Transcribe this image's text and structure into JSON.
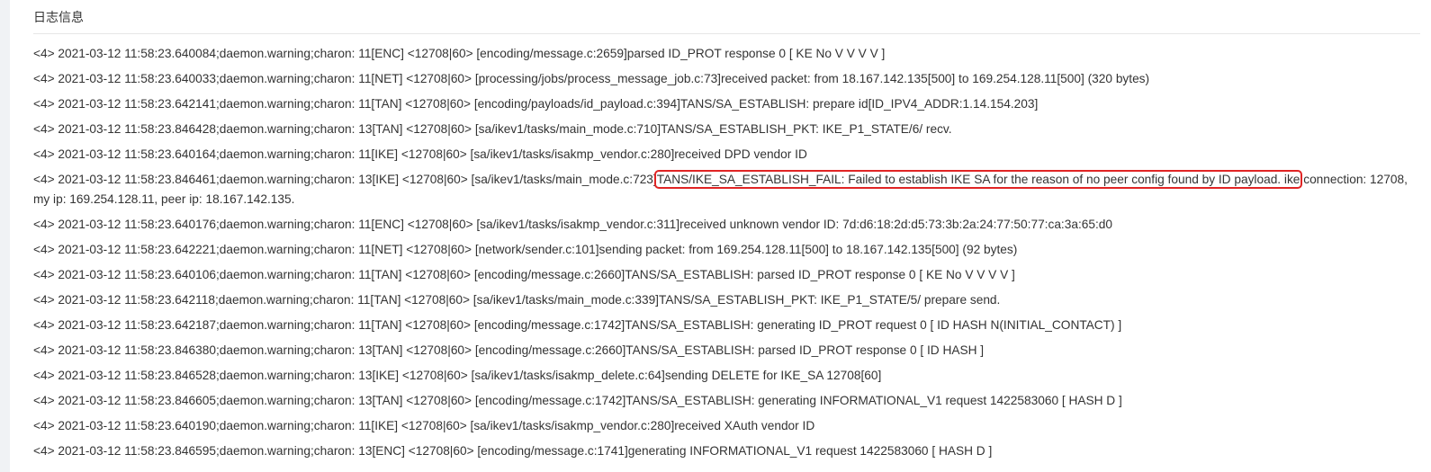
{
  "panel": {
    "title": "日志信息"
  },
  "logs": [
    {
      "prefix": "<4> 2021-03-12 11:58:23.640084;daemon.warning;charon: 11[ENC] <12708|60> [encoding/message.c:2659]parsed ID_PROT response 0 [ KE No V V V V ]",
      "highlight": "",
      "suffix": ""
    },
    {
      "prefix": "<4> 2021-03-12 11:58:23.640033;daemon.warning;charon: 11[NET] <12708|60> [processing/jobs/process_message_job.c:73]received packet: from 18.167.142.135[500] to 169.254.128.11[500] (320 bytes)",
      "highlight": "",
      "suffix": ""
    },
    {
      "prefix": "<4> 2021-03-12 11:58:23.642141;daemon.warning;charon: 11[TAN] <12708|60> [encoding/payloads/id_payload.c:394]TANS/SA_ESTABLISH: prepare id[ID_IPV4_ADDR:1.14.154.203]",
      "highlight": "",
      "suffix": ""
    },
    {
      "prefix": "<4> 2021-03-12 11:58:23.846428;daemon.warning;charon: 13[TAN] <12708|60> [sa/ikev1/tasks/main_mode.c:710]TANS/SA_ESTABLISH_PKT: IKE_P1_STATE/6/ recv.",
      "highlight": "",
      "suffix": ""
    },
    {
      "prefix": "<4> 2021-03-12 11:58:23.640164;daemon.warning;charon: 11[IKE] <12708|60> [sa/ikev1/tasks/isakmp_vendor.c:280]received DPD vendor ID",
      "highlight": "",
      "suffix": ""
    },
    {
      "prefix": "<4> 2021-03-12 11:58:23.846461;daemon.warning;charon: 13[IKE] <12708|60> [sa/ikev1/tasks/main_mode.c:723]",
      "highlight": "TANS/IKE_SA_ESTABLISH_FAIL: Failed to establish IKE SA for the reason of no peer config found by ID payload. ike",
      "suffix": " connection: 12708, my ip: 169.254.128.11, peer ip: 18.167.142.135."
    },
    {
      "prefix": "<4> 2021-03-12 11:58:23.640176;daemon.warning;charon: 11[ENC] <12708|60> [sa/ikev1/tasks/isakmp_vendor.c:311]received unknown vendor ID: 7d:d6:18:2d:d5:73:3b:2a:24:77:50:77:ca:3a:65:d0",
      "highlight": "",
      "suffix": ""
    },
    {
      "prefix": "<4> 2021-03-12 11:58:23.642221;daemon.warning;charon: 11[NET] <12708|60> [network/sender.c:101]sending packet: from 169.254.128.11[500] to 18.167.142.135[500] (92 bytes)",
      "highlight": "",
      "suffix": ""
    },
    {
      "prefix": "<4> 2021-03-12 11:58:23.640106;daemon.warning;charon: 11[TAN] <12708|60> [encoding/message.c:2660]TANS/SA_ESTABLISH: parsed ID_PROT response 0 [ KE No V V V V ]",
      "highlight": "",
      "suffix": ""
    },
    {
      "prefix": "<4> 2021-03-12 11:58:23.642118;daemon.warning;charon: 11[TAN] <12708|60> [sa/ikev1/tasks/main_mode.c:339]TANS/SA_ESTABLISH_PKT: IKE_P1_STATE/5/ prepare send.",
      "highlight": "",
      "suffix": ""
    },
    {
      "prefix": "<4> 2021-03-12 11:58:23.642187;daemon.warning;charon: 11[TAN] <12708|60> [encoding/message.c:1742]TANS/SA_ESTABLISH: generating ID_PROT request 0 [ ID HASH N(INITIAL_CONTACT) ]",
      "highlight": "",
      "suffix": ""
    },
    {
      "prefix": "<4> 2021-03-12 11:58:23.846380;daemon.warning;charon: 13[TAN] <12708|60> [encoding/message.c:2660]TANS/SA_ESTABLISH: parsed ID_PROT response 0 [ ID HASH ]",
      "highlight": "",
      "suffix": ""
    },
    {
      "prefix": "<4> 2021-03-12 11:58:23.846528;daemon.warning;charon: 13[IKE] <12708|60> [sa/ikev1/tasks/isakmp_delete.c:64]sending DELETE for IKE_SA 12708[60]",
      "highlight": "",
      "suffix": ""
    },
    {
      "prefix": "<4> 2021-03-12 11:58:23.846605;daemon.warning;charon: 13[TAN] <12708|60> [encoding/message.c:1742]TANS/SA_ESTABLISH: generating INFORMATIONAL_V1 request 1422583060 [ HASH D ]",
      "highlight": "",
      "suffix": ""
    },
    {
      "prefix": "<4> 2021-03-12 11:58:23.640190;daemon.warning;charon: 11[IKE] <12708|60> [sa/ikev1/tasks/isakmp_vendor.c:280]received XAuth vendor ID",
      "highlight": "",
      "suffix": ""
    },
    {
      "prefix": "<4> 2021-03-12 11:58:23.846595;daemon.warning;charon: 13[ENC] <12708|60> [encoding/message.c:1741]generating INFORMATIONAL_V1 request 1422583060 [ HASH D ]",
      "highlight": "",
      "suffix": ""
    }
  ]
}
